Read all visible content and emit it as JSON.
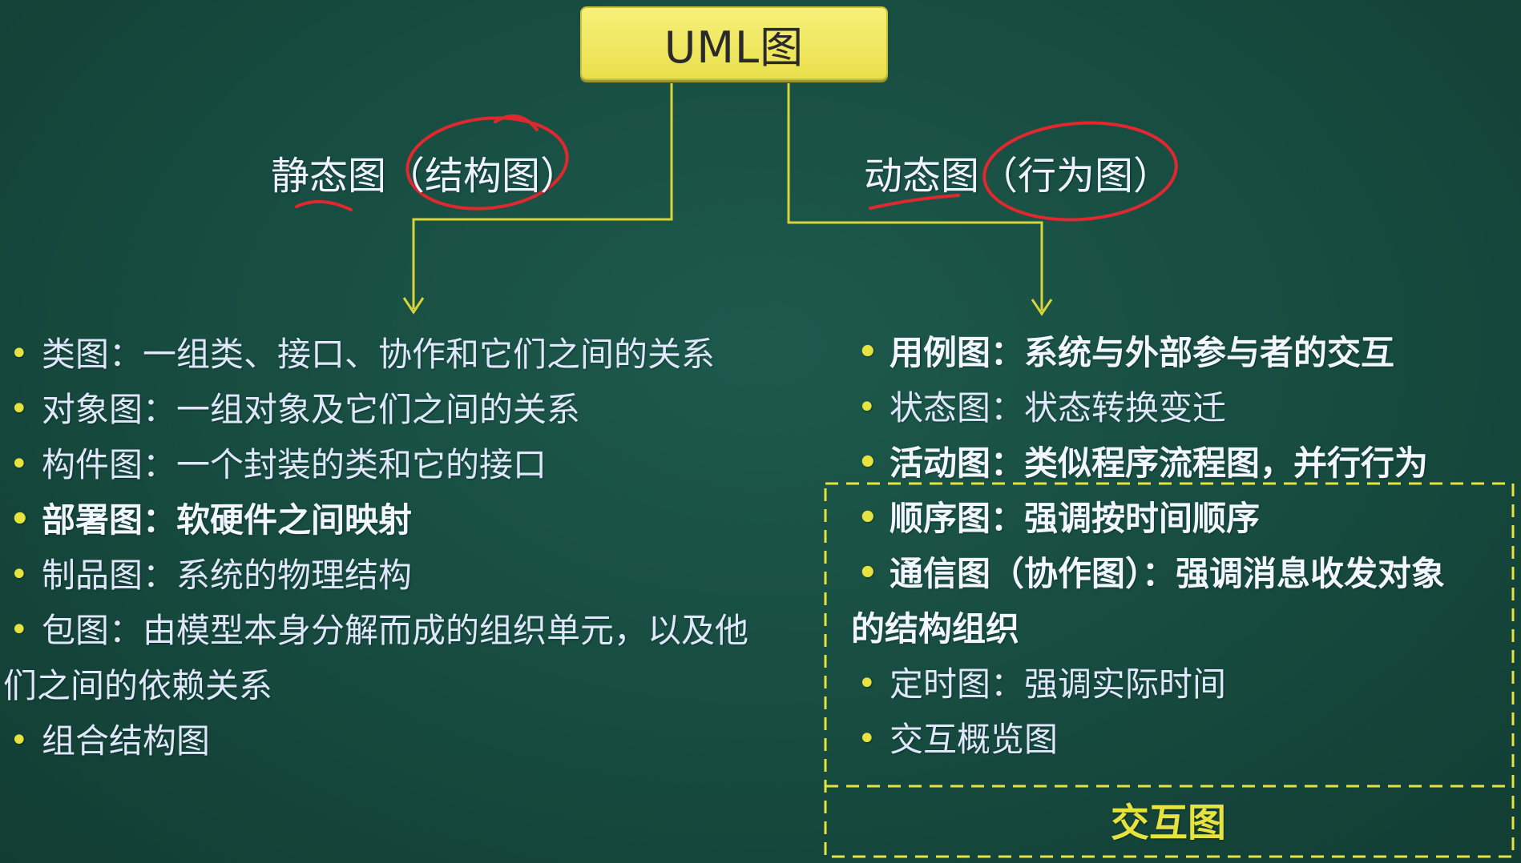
{
  "root": {
    "label": "UML图"
  },
  "static_branch": {
    "title": "静态图（结构图）",
    "items": [
      {
        "label": "类图：一组类、接口、协作和它们之间的关系",
        "bold": false
      },
      {
        "label": "对象图：一组对象及它们之间的关系",
        "bold": false
      },
      {
        "label": "构件图：一个封装的类和它的接口",
        "bold": false
      },
      {
        "label": "部署图：软硬件之间映射",
        "bold": true
      },
      {
        "label": "制品图：系统的物理结构",
        "bold": false
      },
      {
        "label": "包图：由模型本身分解而成的组织单元，以及他",
        "continuation": "们之间的依赖关系",
        "bold": false
      },
      {
        "label": "组合结构图",
        "bold": false
      }
    ]
  },
  "dynamic_branch": {
    "title": "动态图（行为图）",
    "items": [
      {
        "label": "用例图：系统与外部参与者的交互",
        "bold": true
      },
      {
        "label": "状态图：状态转换变迁",
        "bold": false
      },
      {
        "label": "活动图：类似程序流程图，并行行为",
        "bold": true
      },
      {
        "label": "顺序图：强调按时间顺序",
        "bold": true
      },
      {
        "label": "通信图（协作图）：强调消息收发对象",
        "continuation": "的结构组织",
        "bold": true
      },
      {
        "label": "定时图：强调实际时间",
        "bold": false
      },
      {
        "label": "交互概览图",
        "bold": false
      }
    ],
    "group_label": "交互图"
  },
  "colors": {
    "background": "#174b3f",
    "root_fill": "#f0e85a",
    "connector": "#e6e23f",
    "annotation": "#e0282f",
    "text": "#dfe8fb"
  }
}
